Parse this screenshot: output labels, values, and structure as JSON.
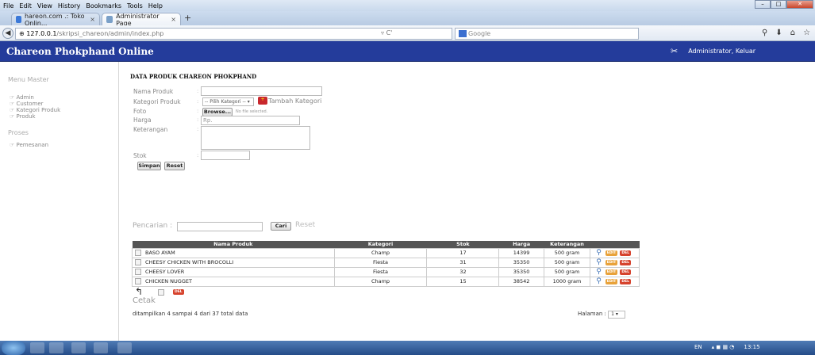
{
  "menubar": {
    "items": [
      "File",
      "Edit",
      "View",
      "History",
      "Bookmarks",
      "Tools",
      "Help"
    ]
  },
  "tabs": [
    {
      "title": "hareon.com .: Toko Onlin...",
      "close": "×"
    },
    {
      "title": "Administrator Page",
      "close": "×"
    }
  ],
  "newtab": "+",
  "url": {
    "host": "127.0.0.1",
    "path": "/skripsi_chareon/admin/index.php"
  },
  "search": {
    "placeholder": "Google"
  },
  "app": {
    "title": "Chareon Phokphand Online",
    "admin_text": "Administrator, Keluar"
  },
  "sidebar": {
    "menu_master": "Menu Master",
    "items": [
      "Admin",
      "Customer",
      "Kategori Produk",
      "Produk"
    ],
    "proses": "Proses",
    "proses_items": [
      "Pemesanan"
    ]
  },
  "page": {
    "title": "DATA PRODUK CHAREON PHOKPHAND",
    "labels": {
      "nama": "Nama Produk",
      "kategori": "Kategori Produk",
      "foto": "Foto",
      "harga": "Harga",
      "keterangan": "Keterangan",
      "stok": "Stok"
    },
    "kategori_select": "-- Pilih Kategori --",
    "tambah_kategori": "Tambah Kategori",
    "browse": "Browse...",
    "no_file": "No file selected.",
    "harga_prefix": "Rp.",
    "simpan": "Simpan",
    "reset": "Reset"
  },
  "searchrow": {
    "label": "Pencarian :",
    "cari": "Cari",
    "reset": "Reset"
  },
  "table": {
    "headers": [
      "Nama Produk",
      "Kategori",
      "Stok",
      "Harga",
      "Keterangan"
    ],
    "rows": [
      {
        "nama": "BASO AYAM",
        "kategori": "Champ",
        "stok": "17",
        "harga": "14399",
        "ket": "500 gram"
      },
      {
        "nama": "CHEESY CHICKEN WITH BROCOLLI",
        "kategori": "Fiesta",
        "stok": "31",
        "harga": "35350",
        "ket": "500 gram"
      },
      {
        "nama": "CHEESY LOVER",
        "kategori": "Fiesta",
        "stok": "32",
        "harga": "35350",
        "ket": "500 gram"
      },
      {
        "nama": "CHICKEN NUGGET",
        "kategori": "Champ",
        "stok": "15",
        "harga": "38542",
        "ket": "1000 gram"
      }
    ],
    "edit_tag": "EDIT",
    "del_tag": "DEL"
  },
  "cetak": "Cetak",
  "summary": "ditampilkan 4 sampai 4 dari 37 total data",
  "halaman": {
    "label": "Halaman :",
    "value": "1"
  },
  "taskbar": {
    "lang": "EN",
    "time": "13:15"
  },
  "colors": {
    "header_bg": "#243c9b",
    "table_header": "#555555",
    "edit": "#e8a23a",
    "del": "#d6432d"
  }
}
